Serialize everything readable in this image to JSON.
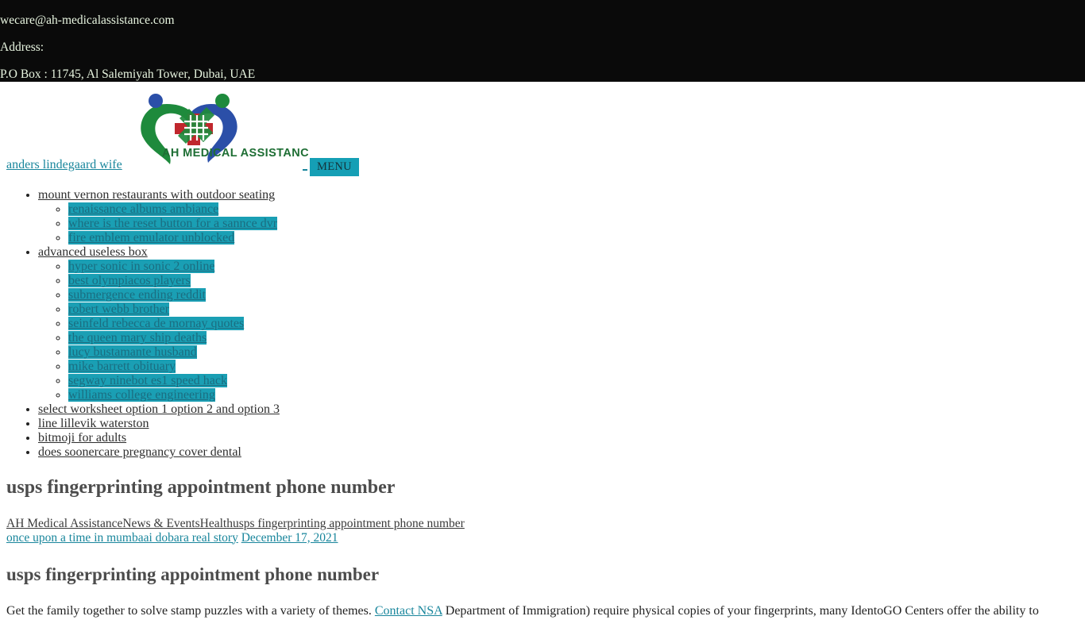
{
  "topbar": {
    "email": "wecare@ah-medicalassistance.com",
    "address_label": "Address:",
    "address_value": "P.O Box : 11745, Al Salemiyah Tower, Dubai, UAE",
    "text_color": "#e8f5e0",
    "bg_color": "#0a0a0a"
  },
  "header": {
    "brand_link": "anders lindegaard wife",
    "menu_button": "MENU",
    "logo_alt": "AH MEDICAL ASSISTANCE",
    "logo_text": "AH MEDICAL ASSISTANCE",
    "accent_teal": "#159fb5",
    "logo_green": "#1e8a3c",
    "logo_blue": "#2b4fa8",
    "logo_red": "#c0272d"
  },
  "nav": {
    "items": [
      {
        "label": "mount vernon restaurants with outdoor seating",
        "highlighted": false,
        "children": [
          {
            "label": "renaissance albums ambiance",
            "highlighted": true
          },
          {
            "label": "where is the reset button for a sannce dvr",
            "highlighted": true
          },
          {
            "label": "fire emblem emulator unblocked",
            "highlighted": true
          }
        ]
      },
      {
        "label": "advanced useless box",
        "highlighted": false,
        "children": [
          {
            "label": "hyper sonic in sonic 2 online",
            "highlighted": true
          },
          {
            "label": "best olympiacos players",
            "highlighted": true
          },
          {
            "label": "submergence ending reddit",
            "highlighted": true
          },
          {
            "label": "robert webb brother",
            "highlighted": true
          },
          {
            "label": "seinfeld rebecca de mornay quotes",
            "highlighted": true
          },
          {
            "label": "the queen mary ship deaths",
            "highlighted": true
          },
          {
            "label": "lucy bustamante husband",
            "highlighted": true
          },
          {
            "label": "mike barrett obituary",
            "highlighted": true
          },
          {
            "label": "segway ninebot es1 speed hack",
            "highlighted": true
          },
          {
            "label": "williams college engineering",
            "highlighted": true
          }
        ]
      },
      {
        "label": "select worksheet option 1 option 2 and option 3",
        "highlighted": false,
        "children": []
      },
      {
        "label": "line lillevik waterston",
        "highlighted": false,
        "children": []
      },
      {
        "label": "bitmoji for adults",
        "highlighted": false,
        "children": []
      },
      {
        "label": "does soonercare pregnancy cover dental",
        "highlighted": false,
        "children": []
      }
    ]
  },
  "main": {
    "page_title": "usps fingerprinting appointment phone number",
    "breadcrumb_line1": "AH Medical AssistanceNews & EventsHealthusps fingerprinting appointment phone number",
    "breadcrumb_author": "once upon a time in mumbaai dobara real story",
    "breadcrumb_date": "December 17, 2021",
    "entry_title": "usps fingerprinting appointment phone number",
    "body_before_link": "Get the family together to solve stamp puzzles with a variety of themes. ",
    "body_link": "Contact NSA",
    "body_after_link": " Department of Immigration) require physical copies of your fingerprints, many IdentoGO Centers offer the ability to"
  }
}
